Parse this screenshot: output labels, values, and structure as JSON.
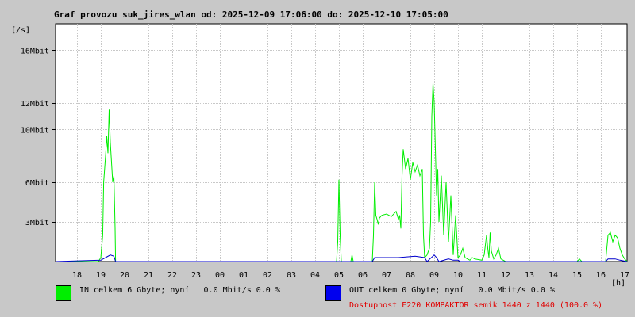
{
  "chart_data": {
    "type": "line",
    "title": "Graf provozu suk_jires_wlan od: 2025-12-09 17:06:00 do: 2025-12-10 17:05:00",
    "ylabel": "[/s]",
    "xlabel": "[h]",
    "y_ticks": [
      {
        "value": 3,
        "label": "3Mbit"
      },
      {
        "value": 6,
        "label": "6Mbit"
      },
      {
        "value": 10,
        "label": "10Mbit"
      },
      {
        "value": 12,
        "label": "12Mbit"
      },
      {
        "value": 16,
        "label": "16Mbit"
      }
    ],
    "ylim": [
      0,
      18
    ],
    "xlim": [
      17.1,
      41.1
    ],
    "x_ticks": [
      {
        "value": 18,
        "label": "18"
      },
      {
        "value": 19,
        "label": "19"
      },
      {
        "value": 20,
        "label": "20"
      },
      {
        "value": 21,
        "label": "21"
      },
      {
        "value": 22,
        "label": "22"
      },
      {
        "value": 23,
        "label": "23"
      },
      {
        "value": 24,
        "label": "00"
      },
      {
        "value": 25,
        "label": "01"
      },
      {
        "value": 26,
        "label": "02"
      },
      {
        "value": 27,
        "label": "03"
      },
      {
        "value": 28,
        "label": "04"
      },
      {
        "value": 29,
        "label": "05"
      },
      {
        "value": 30,
        "label": "06"
      },
      {
        "value": 31,
        "label": "07"
      },
      {
        "value": 32,
        "label": "08"
      },
      {
        "value": 33,
        "label": "09"
      },
      {
        "value": 34,
        "label": "10"
      },
      {
        "value": 35,
        "label": "11"
      },
      {
        "value": 36,
        "label": "12"
      },
      {
        "value": 37,
        "label": "13"
      },
      {
        "value": 38,
        "label": "14"
      },
      {
        "value": 39,
        "label": "15"
      },
      {
        "value": 40,
        "label": "16"
      },
      {
        "value": 41,
        "label": "17"
      }
    ],
    "grid": true,
    "series": [
      {
        "name": "IN",
        "color": "#00ee00",
        "x": [
          17.1,
          18.9,
          19.0,
          19.08,
          19.12,
          19.2,
          19.25,
          19.3,
          19.35,
          19.4,
          19.45,
          19.5,
          19.55,
          19.6,
          19.62,
          28.9,
          28.95,
          29.0,
          29.05,
          29.1,
          29.5,
          29.55,
          29.6,
          30.4,
          30.45,
          30.5,
          30.55,
          30.6,
          30.65,
          30.7,
          30.8,
          31.0,
          31.2,
          31.4,
          31.5,
          31.55,
          31.6,
          31.65,
          31.7,
          31.8,
          31.9,
          32.0,
          32.1,
          32.2,
          32.3,
          32.4,
          32.5,
          32.55,
          32.6,
          32.7,
          32.8,
          32.85,
          32.9,
          32.95,
          33.0,
          33.05,
          33.1,
          33.15,
          33.2,
          33.3,
          33.4,
          33.5,
          33.6,
          33.7,
          33.8,
          33.9,
          34.0,
          34.1,
          34.2,
          34.3,
          34.4,
          34.5,
          34.6,
          34.7,
          35.0,
          35.1,
          35.2,
          35.25,
          35.3,
          35.35,
          35.4,
          35.5,
          35.6,
          35.7,
          35.8,
          35.9,
          36.0,
          38.0,
          39.0,
          39.1,
          39.2,
          40.2,
          40.3,
          40.4,
          40.5,
          40.6,
          40.7,
          40.8,
          40.9,
          41.0,
          41.1
        ],
        "values": [
          0,
          0,
          0.3,
          2.0,
          6.0,
          8.0,
          9.5,
          8.2,
          11.5,
          9.0,
          7.5,
          6.0,
          6.5,
          2.5,
          0,
          0,
          1.5,
          6.2,
          2.0,
          0,
          0,
          0.5,
          0,
          0,
          2.0,
          6.0,
          3.5,
          3.2,
          2.8,
          3.3,
          3.5,
          3.6,
          3.4,
          3.8,
          3.2,
          3.5,
          2.5,
          6.5,
          8.5,
          7.0,
          7.8,
          6.2,
          7.5,
          6.8,
          7.3,
          6.5,
          7.0,
          2.0,
          0.3,
          0.5,
          1.0,
          3.0,
          11.0,
          13.5,
          12.0,
          8.5,
          5.0,
          7.0,
          3.0,
          6.5,
          2.0,
          6.0,
          1.5,
          5.0,
          0.5,
          3.5,
          0.3,
          0.5,
          1.0,
          0.3,
          0.2,
          0.1,
          0.3,
          0.2,
          0.1,
          0.5,
          2.0,
          1.0,
          0.3,
          2.2,
          0.8,
          0.2,
          0.5,
          1.0,
          0.2,
          0.1,
          0,
          0,
          0,
          0.2,
          0,
          0,
          2.0,
          2.2,
          1.5,
          2.0,
          1.8,
          1.0,
          0.5,
          0.2,
          0
        ]
      },
      {
        "name": "OUT",
        "color": "#0000cc",
        "x": [
          17.1,
          19.0,
          19.2,
          19.4,
          19.55,
          19.62,
          30.4,
          30.5,
          31.5,
          32.2,
          32.6,
          32.7,
          33.0,
          33.1,
          33.2,
          33.6,
          33.8,
          34.0,
          34.1,
          40.2,
          40.3,
          40.6,
          40.8,
          41.1
        ],
        "values": [
          0,
          0.1,
          0.3,
          0.5,
          0.4,
          0,
          0,
          0.3,
          0.3,
          0.4,
          0.3,
          0,
          0.5,
          0.3,
          0,
          0.2,
          0.1,
          0.1,
          0,
          0,
          0.2,
          0.2,
          0.1,
          0
        ]
      }
    ]
  },
  "legend": {
    "in": {
      "color": "#00ee00",
      "text": "IN celkem 6 Gbyte; nyní   0.0 Mbit/s 0.0 %"
    },
    "out": {
      "color": "#0000ee",
      "text": "OUT celkem 0 Gbyte; nyní   0.0 Mbit/s 0.0 %"
    },
    "availability": {
      "color": "#e00000",
      "text": "Dostupnost E220 KOMPAKTOR semik 1440 z 1440 (100.0 %)"
    }
  }
}
